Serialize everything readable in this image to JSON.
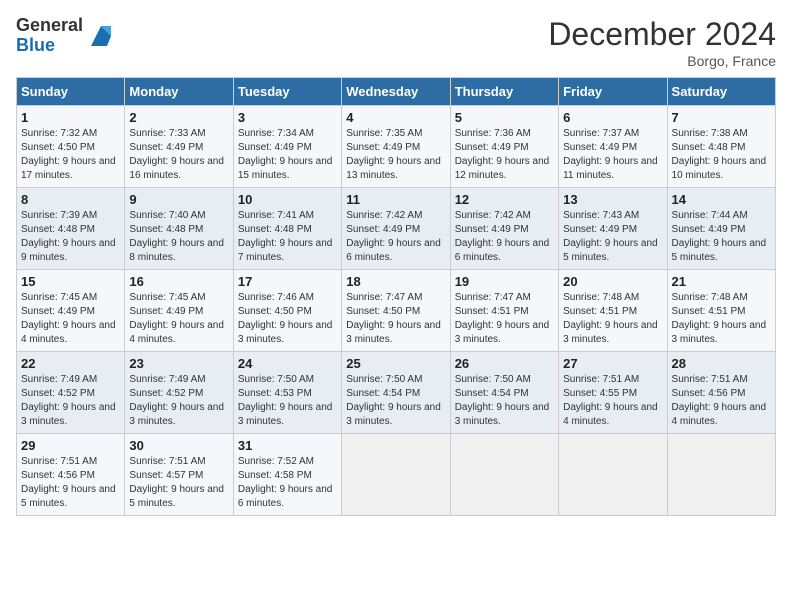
{
  "logo": {
    "general": "General",
    "blue": "Blue"
  },
  "title": "December 2024",
  "location": "Borgo, France",
  "days_header": [
    "Sunday",
    "Monday",
    "Tuesday",
    "Wednesday",
    "Thursday",
    "Friday",
    "Saturday"
  ],
  "weeks": [
    [
      {
        "day": "1",
        "sunrise": "7:32 AM",
        "sunset": "4:50 PM",
        "daylight": "9 hours and 17 minutes."
      },
      {
        "day": "2",
        "sunrise": "7:33 AM",
        "sunset": "4:49 PM",
        "daylight": "9 hours and 16 minutes."
      },
      {
        "day": "3",
        "sunrise": "7:34 AM",
        "sunset": "4:49 PM",
        "daylight": "9 hours and 15 minutes."
      },
      {
        "day": "4",
        "sunrise": "7:35 AM",
        "sunset": "4:49 PM",
        "daylight": "9 hours and 13 minutes."
      },
      {
        "day": "5",
        "sunrise": "7:36 AM",
        "sunset": "4:49 PM",
        "daylight": "9 hours and 12 minutes."
      },
      {
        "day": "6",
        "sunrise": "7:37 AM",
        "sunset": "4:49 PM",
        "daylight": "9 hours and 11 minutes."
      },
      {
        "day": "7",
        "sunrise": "7:38 AM",
        "sunset": "4:48 PM",
        "daylight": "9 hours and 10 minutes."
      }
    ],
    [
      {
        "day": "8",
        "sunrise": "7:39 AM",
        "sunset": "4:48 PM",
        "daylight": "9 hours and 9 minutes."
      },
      {
        "day": "9",
        "sunrise": "7:40 AM",
        "sunset": "4:48 PM",
        "daylight": "9 hours and 8 minutes."
      },
      {
        "day": "10",
        "sunrise": "7:41 AM",
        "sunset": "4:48 PM",
        "daylight": "9 hours and 7 minutes."
      },
      {
        "day": "11",
        "sunrise": "7:42 AM",
        "sunset": "4:49 PM",
        "daylight": "9 hours and 6 minutes."
      },
      {
        "day": "12",
        "sunrise": "7:42 AM",
        "sunset": "4:49 PM",
        "daylight": "9 hours and 6 minutes."
      },
      {
        "day": "13",
        "sunrise": "7:43 AM",
        "sunset": "4:49 PM",
        "daylight": "9 hours and 5 minutes."
      },
      {
        "day": "14",
        "sunrise": "7:44 AM",
        "sunset": "4:49 PM",
        "daylight": "9 hours and 5 minutes."
      }
    ],
    [
      {
        "day": "15",
        "sunrise": "7:45 AM",
        "sunset": "4:49 PM",
        "daylight": "9 hours and 4 minutes."
      },
      {
        "day": "16",
        "sunrise": "7:45 AM",
        "sunset": "4:49 PM",
        "daylight": "9 hours and 4 minutes."
      },
      {
        "day": "17",
        "sunrise": "7:46 AM",
        "sunset": "4:50 PM",
        "daylight": "9 hours and 3 minutes."
      },
      {
        "day": "18",
        "sunrise": "7:47 AM",
        "sunset": "4:50 PM",
        "daylight": "9 hours and 3 minutes."
      },
      {
        "day": "19",
        "sunrise": "7:47 AM",
        "sunset": "4:51 PM",
        "daylight": "9 hours and 3 minutes."
      },
      {
        "day": "20",
        "sunrise": "7:48 AM",
        "sunset": "4:51 PM",
        "daylight": "9 hours and 3 minutes."
      },
      {
        "day": "21",
        "sunrise": "7:48 AM",
        "sunset": "4:51 PM",
        "daylight": "9 hours and 3 minutes."
      }
    ],
    [
      {
        "day": "22",
        "sunrise": "7:49 AM",
        "sunset": "4:52 PM",
        "daylight": "9 hours and 3 minutes."
      },
      {
        "day": "23",
        "sunrise": "7:49 AM",
        "sunset": "4:52 PM",
        "daylight": "9 hours and 3 minutes."
      },
      {
        "day": "24",
        "sunrise": "7:50 AM",
        "sunset": "4:53 PM",
        "daylight": "9 hours and 3 minutes."
      },
      {
        "day": "25",
        "sunrise": "7:50 AM",
        "sunset": "4:54 PM",
        "daylight": "9 hours and 3 minutes."
      },
      {
        "day": "26",
        "sunrise": "7:50 AM",
        "sunset": "4:54 PM",
        "daylight": "9 hours and 3 minutes."
      },
      {
        "day": "27",
        "sunrise": "7:51 AM",
        "sunset": "4:55 PM",
        "daylight": "9 hours and 4 minutes."
      },
      {
        "day": "28",
        "sunrise": "7:51 AM",
        "sunset": "4:56 PM",
        "daylight": "9 hours and 4 minutes."
      }
    ],
    [
      {
        "day": "29",
        "sunrise": "7:51 AM",
        "sunset": "4:56 PM",
        "daylight": "9 hours and 5 minutes."
      },
      {
        "day": "30",
        "sunrise": "7:51 AM",
        "sunset": "4:57 PM",
        "daylight": "9 hours and 5 minutes."
      },
      {
        "day": "31",
        "sunrise": "7:52 AM",
        "sunset": "4:58 PM",
        "daylight": "9 hours and 6 minutes."
      },
      null,
      null,
      null,
      null
    ]
  ]
}
